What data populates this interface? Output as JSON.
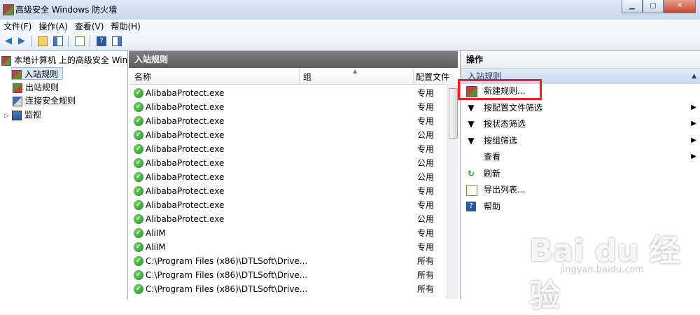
{
  "window": {
    "title": "高级安全 Windows 防火墙"
  },
  "menu": [
    "文件(F)",
    "操作(A)",
    "查看(V)",
    "帮助(H)"
  ],
  "tree": {
    "root": "本地计算机 上的高级安全 Windows 防火墙",
    "items": [
      "入站规则",
      "出站规则",
      "连接安全规则",
      "监视"
    ]
  },
  "middle": {
    "title": "入站规则",
    "columns": {
      "name": "名称",
      "group": "组",
      "profile": "配置文件"
    },
    "rows": [
      {
        "name": "AlibabaProtect.exe",
        "profile": "专用"
      },
      {
        "name": "AlibabaProtect.exe",
        "profile": "专用"
      },
      {
        "name": "AlibabaProtect.exe",
        "profile": "专用"
      },
      {
        "name": "AlibabaProtect.exe",
        "profile": "公用"
      },
      {
        "name": "AlibabaProtect.exe",
        "profile": "专用"
      },
      {
        "name": "AlibabaProtect.exe",
        "profile": "公用"
      },
      {
        "name": "AlibabaProtect.exe",
        "profile": "公用"
      },
      {
        "name": "AlibabaProtect.exe",
        "profile": "专用"
      },
      {
        "name": "AlibabaProtect.exe",
        "profile": "专用"
      },
      {
        "name": "AlibabaProtect.exe",
        "profile": "公用"
      },
      {
        "name": "AliIM",
        "profile": "专用"
      },
      {
        "name": "AliIM",
        "profile": "专用"
      },
      {
        "name": "C:\\Program Files (x86)\\DTLSoft\\Drive...",
        "profile": "所有"
      },
      {
        "name": "C:\\Program Files (x86)\\DTLSoft\\Drive...",
        "profile": "所有"
      },
      {
        "name": "C:\\Program Files (x86)\\DTLSoft\\Drive...",
        "profile": "所有"
      }
    ]
  },
  "actions": {
    "title": "操作",
    "section": "入站规则",
    "items": [
      {
        "label": "新建规则...",
        "icon": "new-rule-icon",
        "arrow": ""
      },
      {
        "label": "按配置文件筛选",
        "icon": "filter-icon",
        "arrow": "▶"
      },
      {
        "label": "按状态筛选",
        "icon": "filter-icon",
        "arrow": "▶"
      },
      {
        "label": "按组筛选",
        "icon": "filter-icon",
        "arrow": "▶"
      },
      {
        "label": "查看",
        "icon": "",
        "arrow": "▶"
      },
      {
        "label": "刷新",
        "icon": "refresh-icon",
        "arrow": ""
      },
      {
        "label": "导出列表...",
        "icon": "export-icon",
        "arrow": ""
      },
      {
        "label": "帮助",
        "icon": "help-icon",
        "arrow": ""
      }
    ]
  },
  "watermark": {
    "brand": "Bai du 经验",
    "url": "jingyan.baidu.com"
  }
}
